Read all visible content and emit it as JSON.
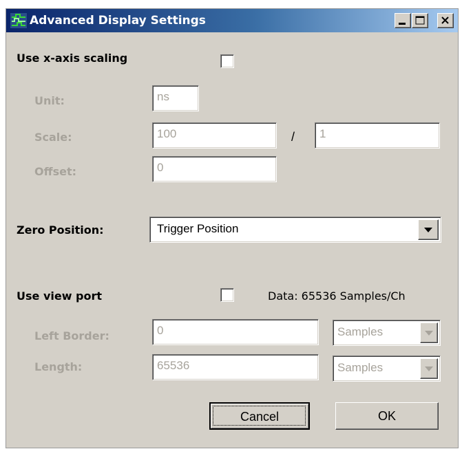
{
  "window": {
    "title": "Advanced Display Settings",
    "icon": "logic-analyzer-app-icon",
    "controls": [
      "minimize-icon",
      "maximize-icon",
      "close-icon"
    ]
  },
  "xaxis": {
    "label": "Use x-axis scaling",
    "checked": false,
    "unit_label": "Unit:",
    "unit_value": "ns",
    "scale_label": "Scale:",
    "scale_value": "100",
    "scale_separator": "/",
    "scale_divisor": "1",
    "offset_label": "Offset:",
    "offset_value": "0"
  },
  "zero": {
    "label": "Zero Position:",
    "selected": "Trigger Position"
  },
  "viewport": {
    "label": "Use view port",
    "checked": false,
    "data_info": "Data: 65536 Samples/Ch",
    "left_border_label": "Left Border:",
    "left_border_value": "0",
    "left_border_unit": "Samples",
    "length_label": "Length:",
    "length_value": "65536",
    "length_unit": "Samples"
  },
  "buttons": {
    "cancel": "Cancel",
    "ok": "OK"
  },
  "colors": {
    "title_bar_start": "#0a246a",
    "title_bar_end": "#a6caf0",
    "dialog_face": "#d4d0c8",
    "disabled_text": "#a7a39b"
  }
}
